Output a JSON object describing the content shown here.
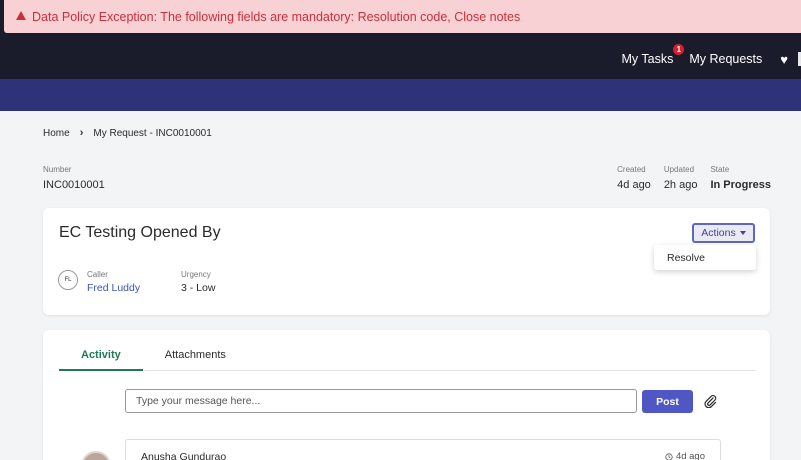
{
  "alert": {
    "message": "Data Policy Exception: The following fields are mandatory: Resolution code, Close notes"
  },
  "nav": {
    "tasks_label": "My Tasks",
    "tasks_badge": "1",
    "requests_label": "My Requests"
  },
  "breadcrumb": {
    "home": "Home",
    "current": "My Request - INC0010001"
  },
  "record": {
    "number_label": "Number",
    "number": "INC0010001",
    "created_label": "Created",
    "created": "4d ago",
    "updated_label": "Updated",
    "updated": "2h ago",
    "state_label": "State",
    "state": "In Progress"
  },
  "case": {
    "title": "EC Testing Opened By",
    "actions_label": "Actions",
    "dropdown_items": [
      "Resolve"
    ],
    "avatar_initials": "FL",
    "caller_label": "Caller",
    "caller": "Fred Luddy",
    "urgency_label": "Urgency",
    "urgency": "3 - Low"
  },
  "activity": {
    "tabs": [
      "Activity",
      "Attachments"
    ],
    "message_placeholder": "Type your message here...",
    "post_label": "Post",
    "feed": [
      {
        "author": "Anusha Gundurao",
        "time": "4d ago"
      }
    ]
  },
  "colors": {
    "header_bg": "#1b1c2b",
    "banner_bg": "#2e3278",
    "alert_bg": "#f7d1d3",
    "alert_text": "#c9303d",
    "accent_green": "#1f7a56",
    "primary_button": "#4f57c4",
    "link": "#3d56b0"
  }
}
